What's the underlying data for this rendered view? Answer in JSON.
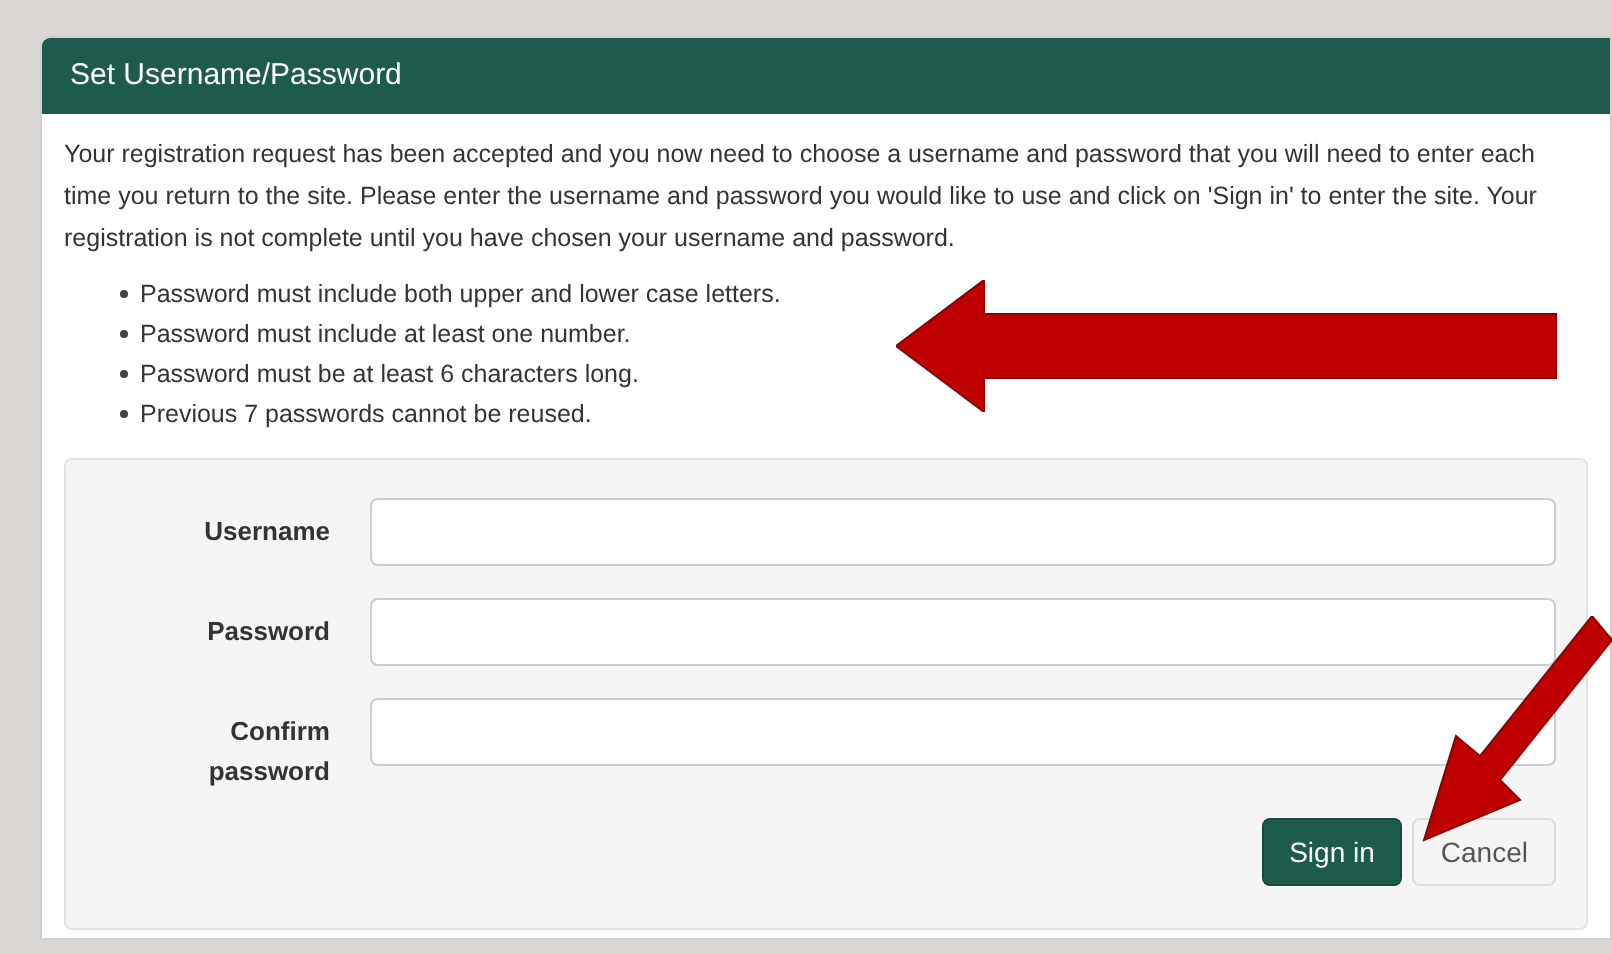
{
  "panel": {
    "title": "Set Username/Password"
  },
  "intro": "Your registration request has been accepted and you now need to choose a username and password that you will need to enter each time you return to the site. Please enter the username and password you would like to use and click on 'Sign in' to enter the site. Your registration is not complete until you have chosen your username and password.",
  "rules": [
    "Password must include both upper and lower case letters.",
    "Password must include at least one number.",
    "Password must be at least 6 characters long.",
    "Previous 7 passwords cannot be reused."
  ],
  "fields": [
    {
      "label": "Username"
    },
    {
      "label": "Password"
    },
    {
      "label": "Confirm password"
    }
  ],
  "buttons": [
    {
      "label": "Sign in",
      "kind": "primary"
    },
    {
      "label": "Cancel",
      "kind": "default"
    }
  ]
}
